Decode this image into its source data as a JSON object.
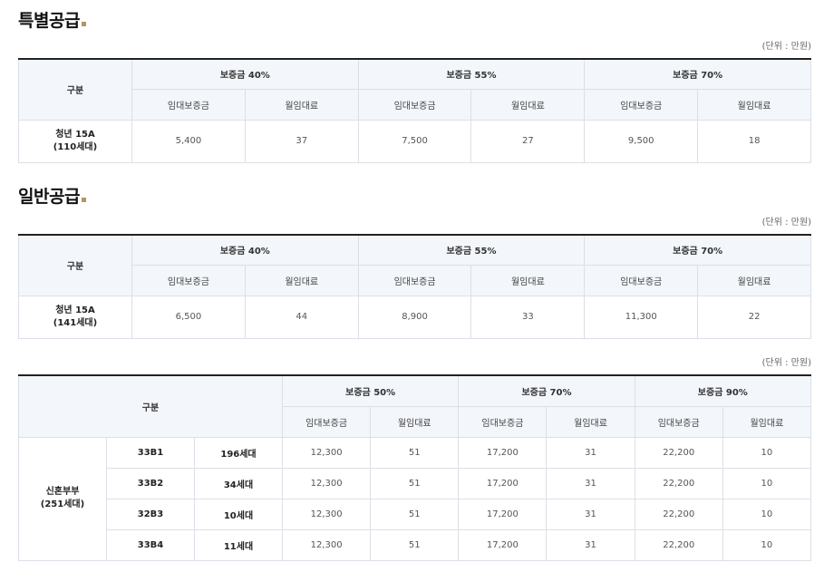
{
  "section1": {
    "title": "특별공급",
    "unit": "(단위 : 만원)",
    "header_label": "구분",
    "groups": [
      "보증금 40%",
      "보증금 55%",
      "보증금 70%"
    ],
    "sub_cols": [
      "임대보증금",
      "월임대료"
    ],
    "row": {
      "label_line1": "청년 15A",
      "label_line2": "(110세대)",
      "values": [
        "5,400",
        "37",
        "7,500",
        "27",
        "9,500",
        "18"
      ]
    }
  },
  "section2": {
    "title": "일반공급",
    "unit": "(단위 : 만원)",
    "header_label": "구분",
    "groups": [
      "보증금 40%",
      "보증금 55%",
      "보증금 70%"
    ],
    "sub_cols": [
      "임대보증금",
      "월임대료"
    ],
    "row": {
      "label_line1": "청년 15A",
      "label_line2": "(141세대)",
      "values": [
        "6,500",
        "44",
        "8,900",
        "33",
        "11,300",
        "22"
      ]
    }
  },
  "section3": {
    "unit": "(단위 : 만원)",
    "header_label": "구분",
    "groups": [
      "보증금 50%",
      "보증금 70%",
      "보증금 90%"
    ],
    "sub_cols": [
      "임대보증금",
      "월임대료"
    ],
    "group_label_line1": "신혼부부",
    "group_label_line2": "(251세대)",
    "rows": [
      {
        "type": "33B1",
        "count": "196세대",
        "values": [
          "12,300",
          "51",
          "17,200",
          "31",
          "22,200",
          "10"
        ]
      },
      {
        "type": "33B2",
        "count": "34세대",
        "values": [
          "12,300",
          "51",
          "17,200",
          "31",
          "22,200",
          "10"
        ]
      },
      {
        "type": "32B3",
        "count": "10세대",
        "values": [
          "12,300",
          "51",
          "17,200",
          "31",
          "22,200",
          "10"
        ]
      },
      {
        "type": "33B4",
        "count": "11세대",
        "values": [
          "12,300",
          "51",
          "17,200",
          "31",
          "22,200",
          "10"
        ]
      }
    ]
  }
}
